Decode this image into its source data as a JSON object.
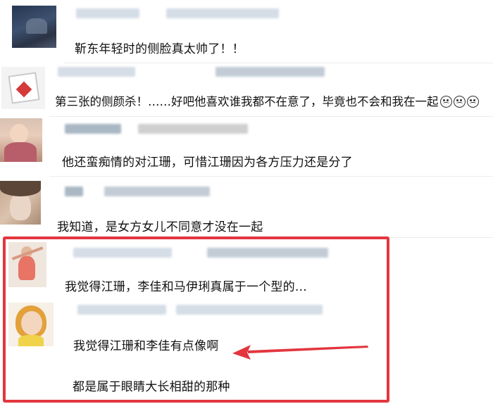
{
  "comments": [
    {
      "text": "靳东年轻时的侧脸真太帅了！！"
    },
    {
      "text": "第三张的侧颜杀！……好吧他喜欢谁我都不在意了，毕竟也不会和我在一起",
      "emojis": [
        "sad-face-icon",
        "sad-face-icon",
        "sad-face-icon"
      ]
    },
    {
      "text": "他还蛮痴情的对江珊，可惜江珊因为各方压力还是分了"
    },
    {
      "text": "我知道，是女方女儿不同意才没在一起"
    },
    {
      "text": "我觉得江珊，李佳和马伊琍真属于一个型的…"
    },
    {
      "text": "我觉得江珊和李佳有点像啊",
      "text2": "都是属于眼睛大长相甜的那种"
    }
  ],
  "colors": {
    "highlight": "#e3363f",
    "arrow": "#e3363f"
  }
}
